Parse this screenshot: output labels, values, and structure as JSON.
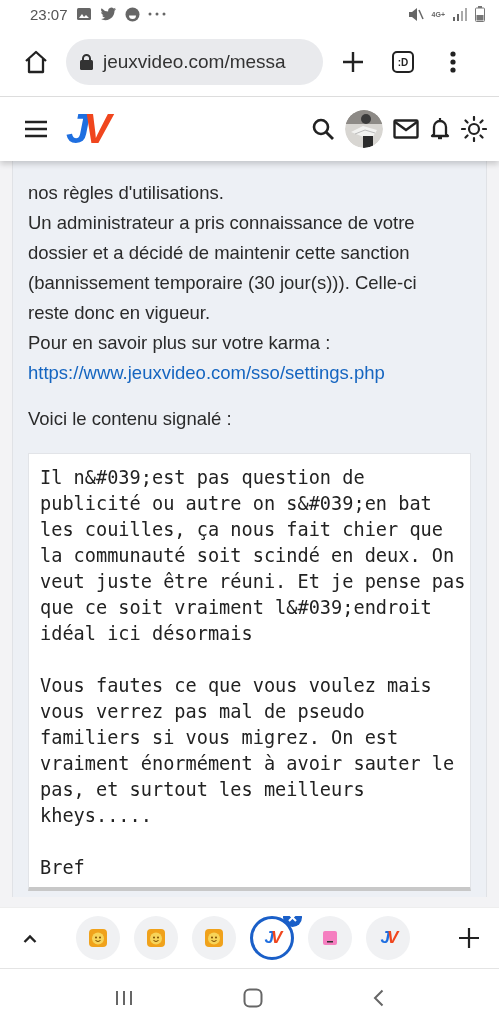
{
  "status_bar": {
    "time": "23:07",
    "network": "4G+"
  },
  "browser": {
    "url": "jeuxvideo.com/messa",
    "tab_switcher": ":D"
  },
  "site_header": {
    "logo": "JV"
  },
  "message": {
    "paragraphs": [
      "nos règles d'utilisations.",
      "Un administrateur a pris connaissance de votre dossier et a décidé de maintenir cette sanction (bannissement temporaire (30 jour(s))). Celle-ci reste donc en vigueur.",
      "Pour en savoir plus sur votre karma :"
    ],
    "link": "https://www.jeuxvideo.com/sso/settings.php",
    "reported_label": "Voici le contenu signalé :",
    "reported_content": [
      "Il n&#039;est pas question de publicité ou autre on s&#039;en bat les couilles, ça nous fait chier que la communauté soit scindé en deux. On veut juste être réuni. Et je pense pas que ce soit vraiment l&#039;endroit idéal ici désormais",
      "Vous fautes ce que vous voulez mais vous verrez pas mal de pseudo familiers si vous migrez. On est vraiment énormément à avoir sauter le pas, et surtout les meilleurs kheys.....",
      "Bref"
    ]
  },
  "tab_strip": {
    "tabs": [
      {
        "kind": "smiley",
        "selected": false
      },
      {
        "kind": "smiley",
        "selected": false
      },
      {
        "kind": "smiley",
        "selected": false
      },
      {
        "kind": "logo",
        "label": "JV",
        "selected": true
      },
      {
        "kind": "pink",
        "selected": false
      },
      {
        "kind": "logo",
        "label": "JV",
        "selected": false
      }
    ]
  }
}
